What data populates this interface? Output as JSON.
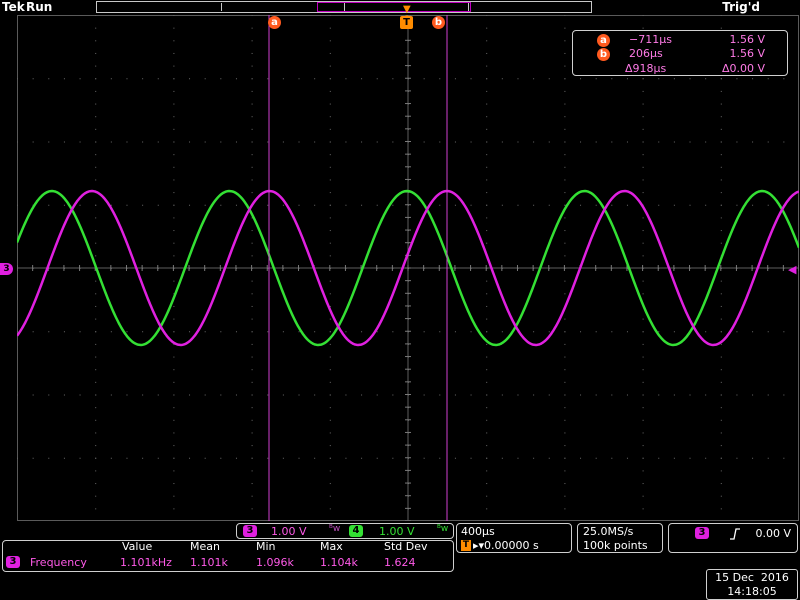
{
  "header": {
    "brand": "Tek",
    "run_state": "Run",
    "trigger_status": "Trig'd"
  },
  "cursors": {
    "a_label": "a",
    "b_label": "b",
    "trigger_marker": "T",
    "readout": {
      "a_time": "−711μs",
      "a_volt": "1.56 V",
      "b_time": "206μs",
      "b_volt": "1.56 V",
      "delta_time": "Δ918μs",
      "delta_volt": "Δ0.00 V"
    }
  },
  "channels": {
    "ch3": {
      "num": "3",
      "scale": "1.00 V",
      "color": "#e020e0"
    },
    "ch4": {
      "num": "4",
      "scale": "1.00 V",
      "color": "#34e034"
    },
    "ground_marker": "3"
  },
  "timebase": {
    "scale": "400μs",
    "trigger_position": "▸▾0.00000 s",
    "sample_rate": "25.0MS/s",
    "record_length": "100k points"
  },
  "trigger": {
    "source": "3",
    "slope_icon": "rising-edge-icon",
    "level": "0.00 V"
  },
  "measurements": {
    "headers": [
      "Value",
      "Mean",
      "Min",
      "Max",
      "Std Dev"
    ],
    "rows": [
      {
        "source": "3",
        "name": "Frequency",
        "value": "1.101kHz",
        "mean": "1.101k",
        "min": "1.096k",
        "max": "1.104k",
        "std_dev": "1.624"
      }
    ]
  },
  "datetime": {
    "date": "15 Dec  2016",
    "time": "14:18:05"
  }
}
